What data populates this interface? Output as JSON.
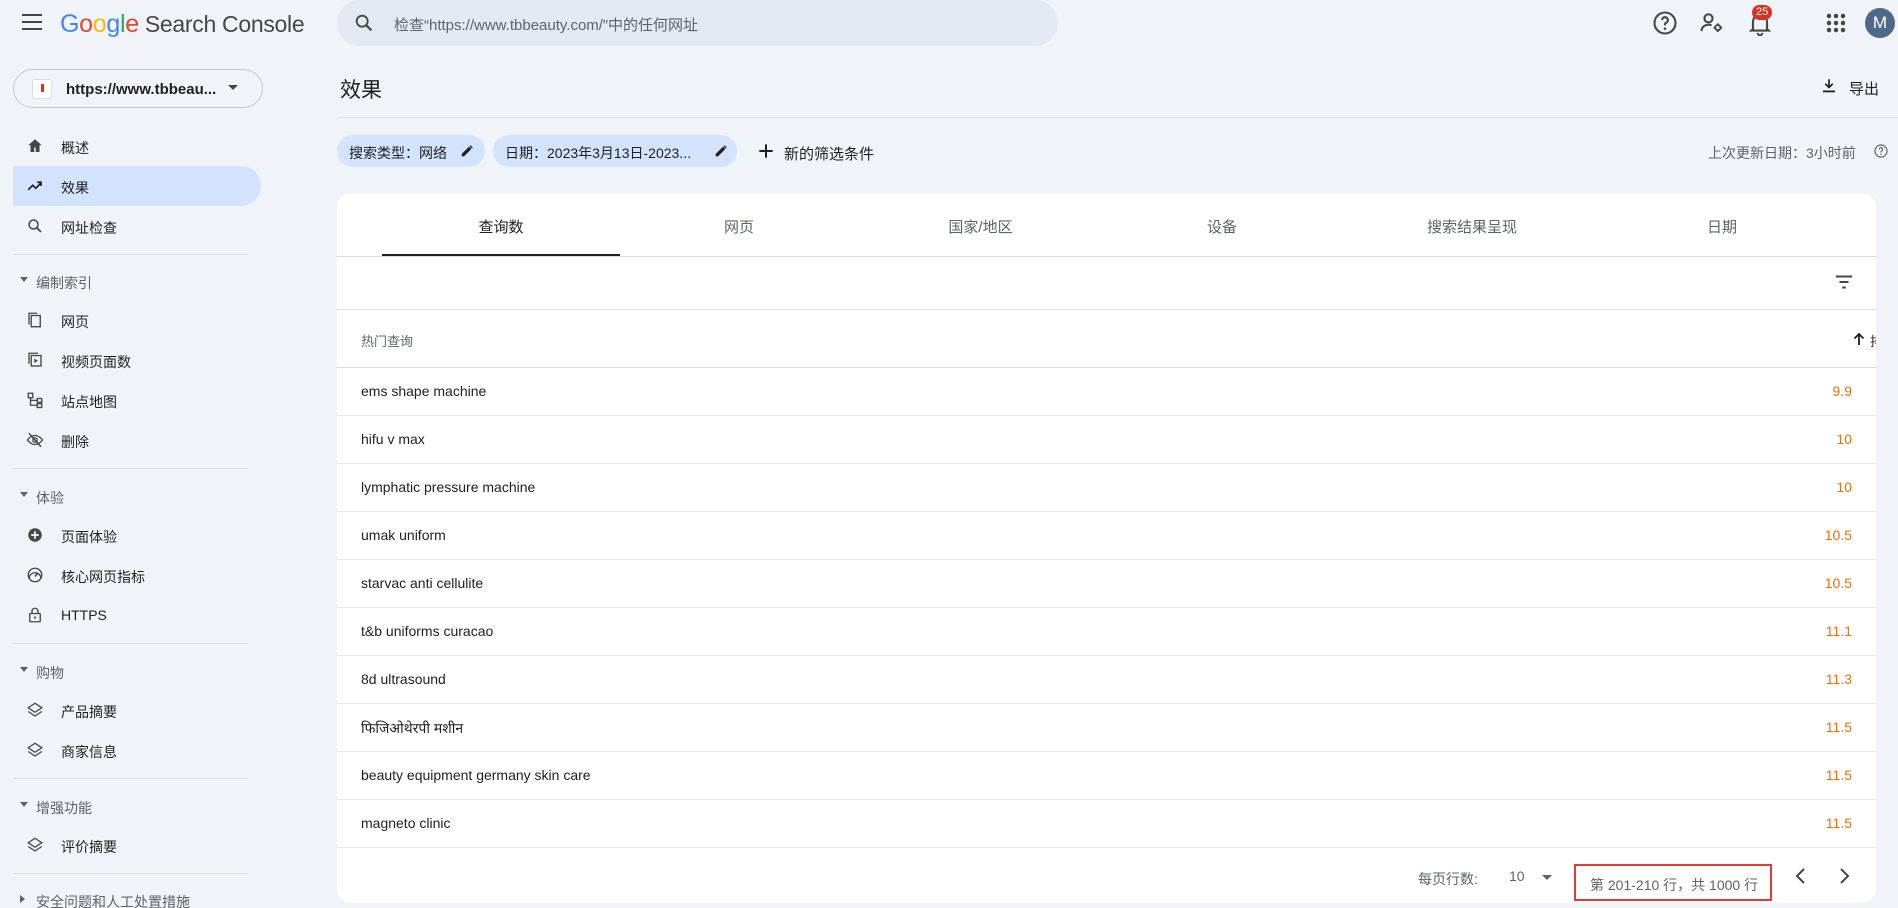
{
  "app": {
    "logo_letters": [
      "G",
      "o",
      "o",
      "g",
      "l",
      "e"
    ],
    "product": "Search Console",
    "search_placeholder": "检查“https://www.tbbeauty.com/”中的任何网址",
    "notification_count": "25",
    "avatar_initial": "M"
  },
  "property": {
    "label": "https://www.tbbeau..."
  },
  "sidebar": {
    "items_top": [
      {
        "label": "概述",
        "icon": "home-icon"
      },
      {
        "label": "效果",
        "icon": "trending-up-icon",
        "active": true
      },
      {
        "label": "网址检查",
        "icon": "search-icon"
      }
    ],
    "sections": [
      {
        "title": "编制索引",
        "items": [
          {
            "label": "网页",
            "icon": "pages-icon"
          },
          {
            "label": "视频页面数",
            "icon": "video-pages-icon"
          },
          {
            "label": "站点地图",
            "icon": "sitemap-icon"
          },
          {
            "label": "删除",
            "icon": "removal-icon"
          }
        ]
      },
      {
        "title": "体验",
        "items": [
          {
            "label": "页面体验",
            "icon": "page-experience-icon"
          },
          {
            "label": "核心网页指标",
            "icon": "speed-icon"
          },
          {
            "label": "HTTPS",
            "icon": "lock-icon"
          }
        ]
      },
      {
        "title": "购物",
        "items": [
          {
            "label": "产品摘要",
            "icon": "layers-icon"
          },
          {
            "label": "商家信息",
            "icon": "layers-icon"
          }
        ]
      },
      {
        "title": "增强功能",
        "items": [
          {
            "label": "评价摘要",
            "icon": "layers-icon"
          }
        ]
      },
      {
        "title": "安全问题和人工处置措施",
        "items": []
      }
    ]
  },
  "main": {
    "title": "效果",
    "export_label": "导出",
    "filters": {
      "search_type": "搜索类型：网络",
      "date": "日期：2023年3月13日-2023...",
      "new_filter": "新的筛选条件"
    },
    "last_updated": "上次更新日期：3小时前"
  },
  "tabs": [
    "查询数",
    "网页",
    "国家/地区",
    "设备",
    "搜索结果呈现",
    "日期"
  ],
  "table": {
    "header_left": "热门查询",
    "header_right": "排名",
    "rows": [
      {
        "query": "ems shape machine",
        "position": "9.9"
      },
      {
        "query": "hifu v max",
        "position": "10"
      },
      {
        "query": "lymphatic pressure machine",
        "position": "10"
      },
      {
        "query": "umak uniform",
        "position": "10.5"
      },
      {
        "query": "starvac anti cellulite",
        "position": "10.5"
      },
      {
        "query": "t&b uniforms curacao",
        "position": "11.1"
      },
      {
        "query": "8d ultrasound",
        "position": "11.3"
      },
      {
        "query": "फिजिओथेरपी मशीन",
        "position": "11.5"
      },
      {
        "query": "beauty equipment germany skin care",
        "position": "11.5"
      },
      {
        "query": "magneto clinic",
        "position": "11.5"
      }
    ]
  },
  "pagination": {
    "rows_per_page_label": "每页行数:",
    "rows_per_page": "10",
    "range_text": "第 201-210 行，共 1000 行"
  },
  "colors": {
    "accent": "#d3e3fd",
    "background": "#f0f4f9",
    "position_value": "#e37400",
    "highlight_box": "#e53935"
  }
}
